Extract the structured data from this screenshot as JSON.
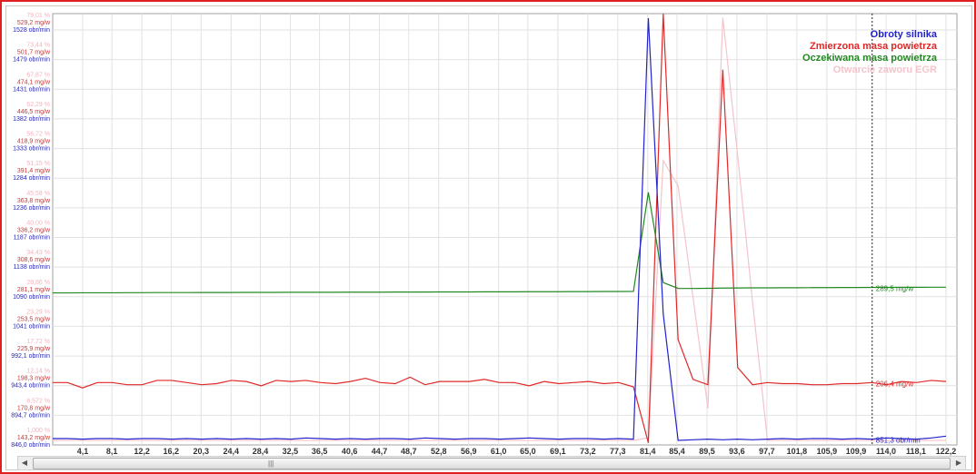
{
  "legend": [
    {
      "label": "Obroty silnika",
      "color": "#2222cc"
    },
    {
      "label": "Zmierzona masa powietrza",
      "color": "#e02828"
    },
    {
      "label": "Oczekiwana masa powietrza",
      "color": "#228822"
    },
    {
      "label": "Otwarcie zaworu EGR",
      "color": "#f4c4cc"
    }
  ],
  "chart_data": {
    "type": "line",
    "xlim": [
      0,
      122.2
    ],
    "x_ticks": [
      "4,1",
      "8,1",
      "12,2",
      "16,2",
      "20,3",
      "24,4",
      "28,4",
      "32,5",
      "36,5",
      "40,6",
      "44,7",
      "48,7",
      "52,8",
      "56,9",
      "61,0",
      "65,0",
      "69,1",
      "73,2",
      "77,3",
      "81,4",
      "85,4",
      "89,5",
      "93,6",
      "97,7",
      "101,8",
      "105,9",
      "109,9",
      "114,0",
      "118,1",
      "122,2"
    ],
    "y_labels": {
      "pct": [
        "1,000 %",
        "6,572 %",
        "12,14 %",
        "17,72 %",
        "23,29 %",
        "28,86 %",
        "34,43 %",
        "40,00 %",
        "45,58 %",
        "51,15 %",
        "56,72 %",
        "62,29 %",
        "67,87 %",
        "73,44 %",
        "79,01 %"
      ],
      "mgw": [
        "143,2 mg/w",
        "170,8 mg/w",
        "198,3 mg/w",
        "225,9 mg/w",
        "253,5 mg/w",
        "281,1 mg/w",
        "308,6 mg/w",
        "336,2 mg/w",
        "363,8 mg/w",
        "391,4 mg/w",
        "418,9 mg/w",
        "446,5 mg/w",
        "474,1 mg/w",
        "501,7 mg/w",
        "529,2 mg/w"
      ],
      "rpm": [
        "846,0 obr/min",
        "894,7 obr/min",
        "943,4 obr/min",
        "992,1 obr/min",
        "1041 obr/min",
        "1090 obr/min",
        "1138 obr/min",
        "1187 obr/min",
        "1236 obr/min",
        "1284 obr/min",
        "1333 obr/min",
        "1382 obr/min",
        "1431 obr/min",
        "1479 obr/min",
        "1528 obr/min"
      ]
    },
    "x_step": 2.037,
    "cursor_x": 112.1,
    "series": [
      {
        "name": "Otwarcie zaworu EGR",
        "axis": "pct",
        "range": [
          1,
          79.01
        ],
        "color": "#f4c4cc",
        "values": [
          1,
          1,
          1,
          1,
          1,
          1,
          1,
          1,
          1,
          1,
          1,
          1,
          1,
          1,
          1,
          1,
          1,
          1,
          1,
          1,
          1,
          1,
          1,
          1,
          1,
          1,
          1,
          1,
          1,
          1,
          1,
          1,
          1,
          1,
          1,
          1,
          1,
          1,
          1,
          1,
          1.5,
          53.6,
          48.8,
          27.9,
          7.0,
          80.5,
          54.5,
          27,
          1,
          1,
          1,
          1,
          1,
          1,
          1,
          1,
          1,
          1,
          1,
          1,
          1
        ]
      },
      {
        "name": "Oczekiwana masa powietrza",
        "axis": "mgw",
        "range": [
          143.2,
          529.2
        ],
        "color": "#228822",
        "values": [
          280.4,
          280.4,
          280.5,
          280.5,
          280.5,
          280.6,
          280.6,
          280.7,
          280.7,
          280.7,
          280.8,
          280.8,
          280.8,
          280.9,
          280.9,
          280.9,
          281.0,
          281.0,
          281.0,
          281.0,
          281.1,
          281.1,
          281.1,
          281.2,
          281.2,
          281.2,
          281.3,
          281.3,
          281.3,
          281.4,
          281.4,
          281.4,
          281.5,
          281.5,
          281.5,
          281.6,
          281.6,
          281.7,
          281.7,
          281.8,
          374,
          290,
          284.6,
          284.5,
          284.7,
          284.9,
          285.0,
          285.1,
          285.1,
          285.2,
          285.2,
          285.3,
          285.3,
          285.4,
          285.4,
          285.5,
          285.5,
          285.6,
          285.6,
          285.7,
          285.7
        ],
        "cursor_label": "289,5 mg/w"
      },
      {
        "name": "Zmierzona masa powietrza",
        "axis": "mgw",
        "range": [
          143.2,
          529.2
        ],
        "color": "#e02828",
        "values": [
          197,
          197,
          192,
          197,
          197,
          195,
          195,
          199,
          199,
          197,
          195,
          196,
          199,
          198,
          194,
          199,
          198,
          199,
          197,
          196,
          198,
          201,
          197,
          196,
          202,
          195,
          198,
          198,
          198,
          200,
          197,
          197,
          194,
          198,
          196,
          197,
          198,
          196,
          197,
          193,
          141,
          540,
          237,
          200,
          195,
          488,
          211,
          195,
          197,
          196,
          196,
          195,
          195,
          196,
          196,
          197,
          195,
          198,
          197,
          199,
          198
        ],
        "cursor_label": "206,4 mg/w"
      },
      {
        "name": "Obroty silnika",
        "axis": "rpm",
        "range": [
          846,
          1528
        ],
        "color": "#2222cc",
        "values": [
          849,
          849,
          848,
          849,
          849,
          848,
          849,
          849,
          848,
          849,
          848,
          849,
          848,
          849,
          848,
          849,
          848,
          850,
          849,
          848,
          849,
          848,
          849,
          849,
          848,
          850,
          849,
          848,
          849,
          849,
          848,
          849,
          850,
          849,
          848,
          849,
          849,
          848,
          849,
          848,
          1540,
          1054,
          846,
          847,
          848,
          847,
          848,
          847,
          848,
          849,
          848,
          849,
          849,
          848,
          849,
          848,
          850,
          849,
          848,
          850,
          853
        ],
        "cursor_label": "851,3 obr/min"
      }
    ]
  }
}
